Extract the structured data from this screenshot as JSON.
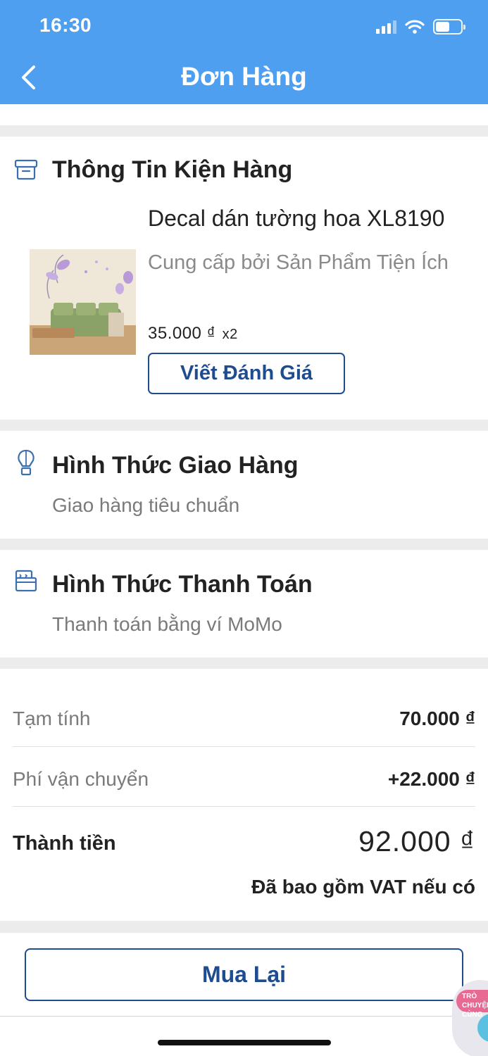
{
  "status_bar": {
    "time": "16:30"
  },
  "header": {
    "title": "Đơn Hàng"
  },
  "package": {
    "title": "Thông Tin Kiện Hàng",
    "product": {
      "name": "Decal dán tường hoa XL8190",
      "provider": "Cung cấp bởi Sản Phẩm Tiện Ích",
      "price": "35.000 ₫",
      "quantity": "x2"
    },
    "review_button": "Viết Đánh Giá"
  },
  "delivery": {
    "title": "Hình Thức Giao Hàng",
    "method": "Giao hàng tiêu chuẩn"
  },
  "payment": {
    "title": "Hình Thức Thanh Toán",
    "method": "Thanh toán bằng ví MoMo"
  },
  "summary": {
    "subtotal_label": "Tạm tính",
    "subtotal_value": "70.000 ₫",
    "shipping_label": "Phí vận chuyển",
    "shipping_value": "+22.000 ₫",
    "total_label": "Thành tiền",
    "total_value": "92.000 ₫",
    "vat_note": "Đã bao gồm VAT nếu có"
  },
  "actions": {
    "buy_again": "Mua Lại"
  },
  "chat_widget": {
    "label": "TRÒ CHUYỆN CÙNG"
  },
  "colors": {
    "header_bg": "#4f9ff0",
    "accent": "#1f4b8f",
    "page_bg": "#ececec"
  }
}
